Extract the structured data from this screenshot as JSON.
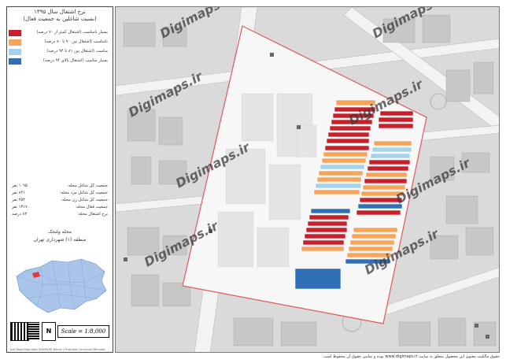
{
  "legend": {
    "title_line1": "نرخ اشتغال سال ۱۳۹۵",
    "title_line2": "(نسبت شاغلین به جمعیت فعال)",
    "items": [
      {
        "label": "بسیار نامناسب (اشتغال کمتر از ۷۰ درصد)",
        "color": "#c8202a"
      },
      {
        "label": "نامناسب (اشتغال بین ۷۰ تا ۸۰ درصد)",
        "color": "#f5a45a"
      },
      {
        "label": "مناسب (اشتغال بین ۸۱ تا ۹۴ درصد)",
        "color": "#a6d3ec"
      },
      {
        "label": "بسیار مناسب (اشتغال بالای ۹۴ درصد)",
        "color": "#2f6fb5"
      }
    ]
  },
  "stats": [
    {
      "label": "جمعیت کل شاغل محله:",
      "value": "۱۰۹۵ نفر"
    },
    {
      "label": "جمعیت کل شاغل مرد محله:",
      "value": "۸۴۱ نفر"
    },
    {
      "label": "جمعیت کل شاغل زن محله:",
      "value": "۲۵۴ نفر"
    },
    {
      "label": "جمعیت فعال محله:",
      "value": "۱۳۱۷ نفر"
    },
    {
      "label": "نرخ اشتغال محله:",
      "value": "۸۳ درصد"
    }
  ],
  "area": {
    "name": "محله ولنجک",
    "district": "منطقه (۱) شهرداری تهران"
  },
  "scale_text": "Scale = 1:8,000",
  "north_label": "N",
  "small_print": "Iran Road Map Data DIGIMAPS Tehran | Projection Universal Mercator",
  "watermark": "Digimaps.ir",
  "footer": "حقوق مالکیت معنوی این محصول متعلق به سایت www.digimaps.ir بوده و تمامی حقوق آن محفوظ است."
}
